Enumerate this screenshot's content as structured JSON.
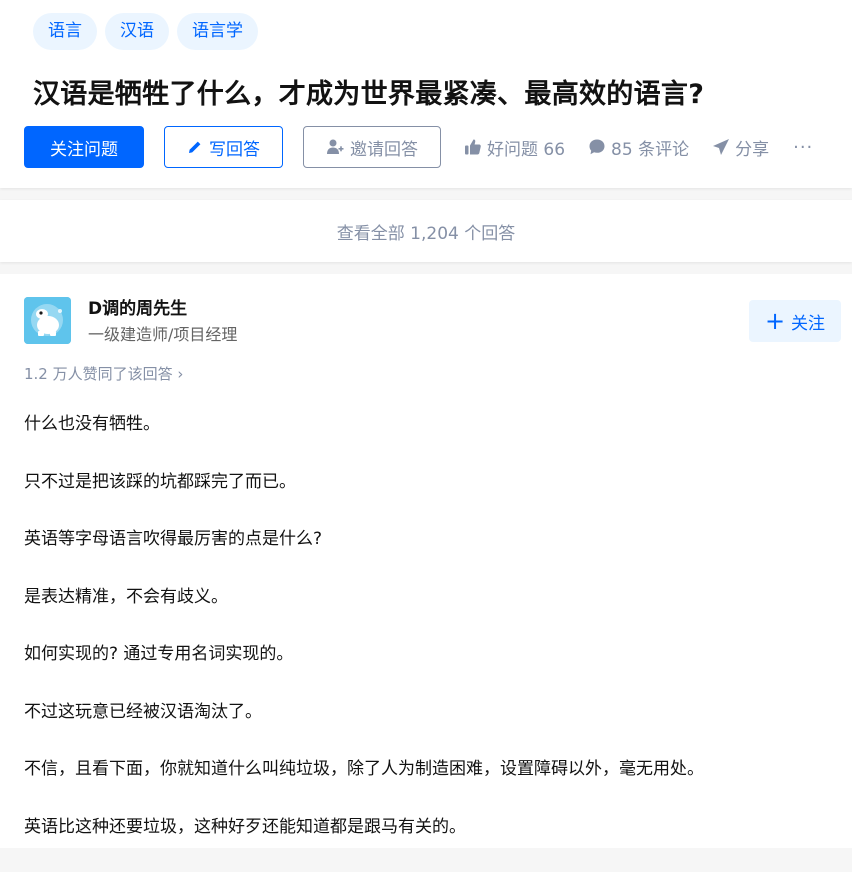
{
  "question": {
    "tags": [
      "语言",
      "汉语",
      "语言学"
    ],
    "title": "汉语是牺牲了什么，才成为世界最紧凑、最高效的语言?",
    "follow_label": "关注问题",
    "write_label": "写回答",
    "invite_label": "邀请回答",
    "good_question_label": "好问题 66",
    "comments_label": "85 条评论",
    "share_label": "分享",
    "more_label": "···"
  },
  "view_all_label": "查看全部 1,204 个回答",
  "answer": {
    "author_name": "D调的周先生",
    "author_bio": "一级建造师/项目经理",
    "follow_label": "关注",
    "votes_label": "1.2 万人赞同了该回答 ›",
    "paragraphs": [
      "什么也没有牺牲。",
      "只不过是把该踩的坑都踩完了而已。",
      "英语等字母语言吹得最厉害的点是什么?",
      "是表达精准，不会有歧义。",
      "如何实现的? 通过专用名词实现的。",
      "不过这玩意已经被汉语淘汰了。",
      "不信，且看下面，你就知道什么叫纯垃圾，除了人为制造困难，设置障碍以外，毫无用处。",
      "英语比这种还要垃圾，这种好歹还能知道都是跟马有关的。"
    ]
  },
  "colors": {
    "brand": "#0066ff",
    "tag_bg": "#ebf5ff",
    "muted": "#8590a6"
  },
  "icons": [
    "pencil-icon",
    "add-user-icon",
    "thumbs-up-icon",
    "comment-icon",
    "paper-plane-icon",
    "plus-icon"
  ]
}
